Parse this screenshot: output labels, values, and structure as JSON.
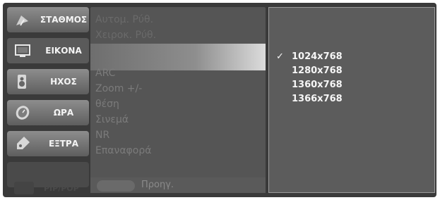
{
  "sidebar": {
    "items": [
      {
        "label": "ΣΤΑΘΜΟΣ",
        "icon": "satellite-dish-icon"
      },
      {
        "label": "ΕΙΚΟΝΑ",
        "icon": "monitor-icon"
      },
      {
        "label": "ΗΧΟΣ",
        "icon": "speaker-icon"
      },
      {
        "label": "ΩΡΑ",
        "icon": "clock-icon"
      },
      {
        "label": "ΕΞΤΡΑ",
        "icon": "tag-icon"
      }
    ],
    "ghost_label": "PIP/POP"
  },
  "submenu": {
    "items": [
      "Αυτομ. Ρύθ.",
      "Χειροκ. Ρύθ.",
      "ARC",
      "Zoom +/-",
      "θέση",
      "Σινεμά",
      "NR",
      "Επαναφορά"
    ],
    "prev_label": "Προηγ."
  },
  "resolutions": {
    "items": [
      "1024x768",
      "1280x768",
      "1360x768",
      "1366x768"
    ],
    "check": "✓"
  }
}
